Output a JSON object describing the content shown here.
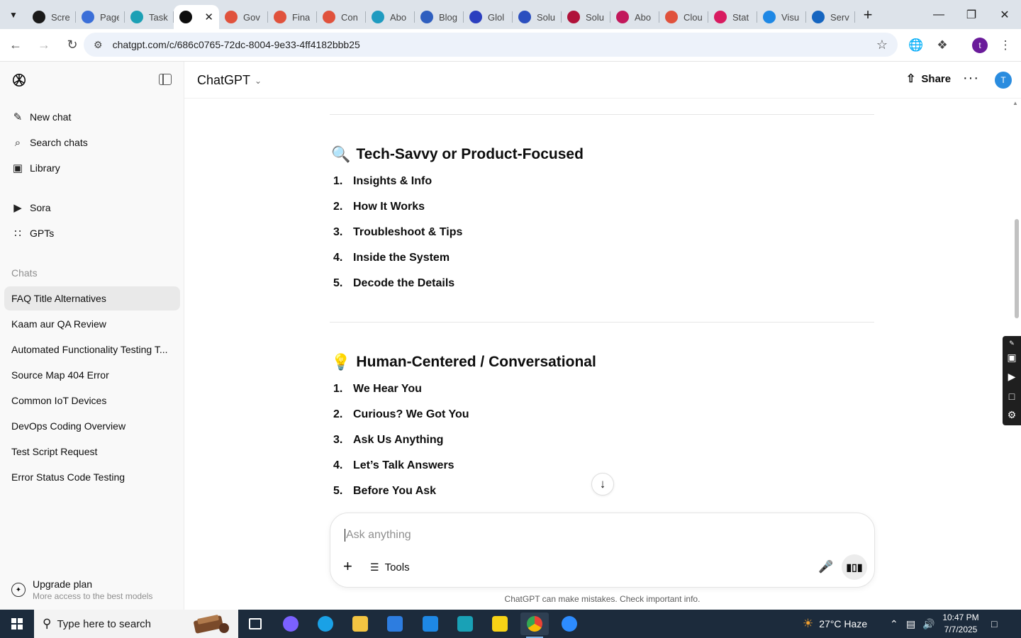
{
  "browser": {
    "tabs": [
      {
        "label": "Scre",
        "color": "#1a1a1a"
      },
      {
        "label": "Page",
        "color": "#3b6fd8"
      },
      {
        "label": "Task",
        "color": "#1ca0b5"
      },
      {
        "label": "",
        "color": "#0d0d0d"
      },
      {
        "label": "Gov",
        "color": "#e0523c"
      },
      {
        "label": "Fina",
        "color": "#e0523c"
      },
      {
        "label": "Con",
        "color": "#e0523c"
      },
      {
        "label": "Abo",
        "color": "#1f9bc0"
      },
      {
        "label": "Blog",
        "color": "#2f5fbf"
      },
      {
        "label": "Glol",
        "color": "#2b3fbf"
      },
      {
        "label": "Solu",
        "color": "#2b4fbf"
      },
      {
        "label": "Solu",
        "color": "#b0123a"
      },
      {
        "label": "Abo",
        "color": "#c2185b"
      },
      {
        "label": "Clou",
        "color": "#e0523c"
      },
      {
        "label": "Stat",
        "color": "#d81b60"
      },
      {
        "label": "Visu",
        "color": "#1e88e5"
      },
      {
        "label": "Serv",
        "color": "#1565c0"
      }
    ],
    "active_tab_index": 3,
    "url": "chatgpt.com/c/686c0765-72dc-8004-9e33-4ff4182bbb25",
    "profile_initial": "t"
  },
  "sidebar": {
    "nav": [
      {
        "label": "New chat",
        "icon": "edit-icon"
      },
      {
        "label": "Search chats",
        "icon": "search-icon"
      },
      {
        "label": "Library",
        "icon": "library-icon"
      },
      {
        "label": "Sora",
        "icon": "play-icon"
      },
      {
        "label": "GPTs",
        "icon": "grid-icon"
      }
    ],
    "section_label": "Chats",
    "chats": [
      "FAQ Title Alternatives",
      "Kaam aur QA Review",
      "Automated Functionality Testing T...",
      "Source Map 404 Error",
      "Common IoT Devices",
      "DevOps Coding Overview",
      "Test Script Request",
      "Error Status Code Testing"
    ],
    "selected_chat_index": 0,
    "upgrade": {
      "title": "Upgrade plan",
      "subtitle": "More access to the best models"
    }
  },
  "header": {
    "model": "ChatGPT",
    "share_label": "Share",
    "user_initial": "T"
  },
  "content": {
    "sections": [
      {
        "emoji": "🔍",
        "heading": "Tech-Savvy or Product-Focused",
        "items": [
          "Insights & Info",
          "How It Works",
          "Troubleshoot & Tips",
          "Inside the System",
          "Decode the Details"
        ]
      },
      {
        "emoji": "💡",
        "heading": "Human-Centered / Conversational",
        "items": [
          "We Hear You",
          "Curious? We Got You",
          "Ask Us Anything",
          "Let’s Talk Answers",
          "Before You Ask"
        ]
      }
    ]
  },
  "composer": {
    "placeholder": "Ask anything",
    "tools_label": "Tools",
    "disclaimer": "ChatGPT can make mistakes. Check important info."
  },
  "taskbar": {
    "search_placeholder": "Type here to search",
    "weather": "27°C  Haze",
    "time": "10:47 PM",
    "date": "7/7/2025",
    "apps": [
      {
        "name": "task-view",
        "color": "#ffffff"
      },
      {
        "name": "copilot",
        "color": "#7b61ff"
      },
      {
        "name": "edge",
        "color": "#1aa1e6"
      },
      {
        "name": "file-explorer",
        "color": "#f4c542"
      },
      {
        "name": "store",
        "color": "#2d7de0"
      },
      {
        "name": "mail",
        "color": "#1e88e5"
      },
      {
        "name": "app-teal",
        "color": "#19a1b6"
      },
      {
        "name": "sticky-notes",
        "color": "#f7d316"
      },
      {
        "name": "chrome",
        "color": "#ea4335"
      },
      {
        "name": "zoom",
        "color": "#2d8cff"
      }
    ]
  }
}
